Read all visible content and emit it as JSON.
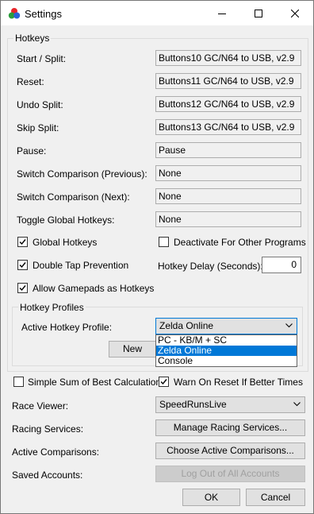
{
  "window": {
    "title": "Settings"
  },
  "hotkeys": {
    "group_title": "Hotkeys",
    "rows": [
      {
        "label": "Start / Split:",
        "value": "Buttons10 GC/N64 to USB, v2.9"
      },
      {
        "label": "Reset:",
        "value": "Buttons11 GC/N64 to USB, v2.9"
      },
      {
        "label": "Undo Split:",
        "value": "Buttons12 GC/N64 to USB, v2.9"
      },
      {
        "label": "Skip Split:",
        "value": "Buttons13 GC/N64 to USB, v2.9"
      },
      {
        "label": "Pause:",
        "value": "Pause"
      },
      {
        "label": "Switch Comparison (Previous):",
        "value": "None"
      },
      {
        "label": "Switch Comparison (Next):",
        "value": "None"
      },
      {
        "label": "Toggle Global Hotkeys:",
        "value": "None"
      }
    ],
    "global_hotkeys": "Global Hotkeys",
    "deactivate_other": "Deactivate For Other Programs",
    "double_tap": "Double Tap Prevention",
    "delay_label": "Hotkey Delay (Seconds):",
    "delay_value": "0",
    "allow_gamepads": "Allow Gamepads as Hotkeys",
    "profiles": {
      "group_title": "Hotkey Profiles",
      "active_label": "Active Hotkey Profile:",
      "selected": "Zelda Online",
      "options": [
        "PC - KB/M + SC",
        "Zelda Online",
        "Console"
      ],
      "new_button": "New"
    }
  },
  "options": {
    "simple_sob": "Simple Sum of Best Calculation",
    "warn_reset": "Warn On Reset If Better Times",
    "race_viewer_label": "Race Viewer:",
    "race_viewer_value": "SpeedRunsLive",
    "racing_services_label": "Racing Services:",
    "racing_services_button": "Manage Racing Services...",
    "active_comparisons_label": "Active Comparisons:",
    "active_comparisons_button": "Choose Active Comparisons...",
    "saved_accounts_label": "Saved Accounts:",
    "saved_accounts_button": "Log Out of All Accounts"
  },
  "footer": {
    "ok": "OK",
    "cancel": "Cancel"
  }
}
